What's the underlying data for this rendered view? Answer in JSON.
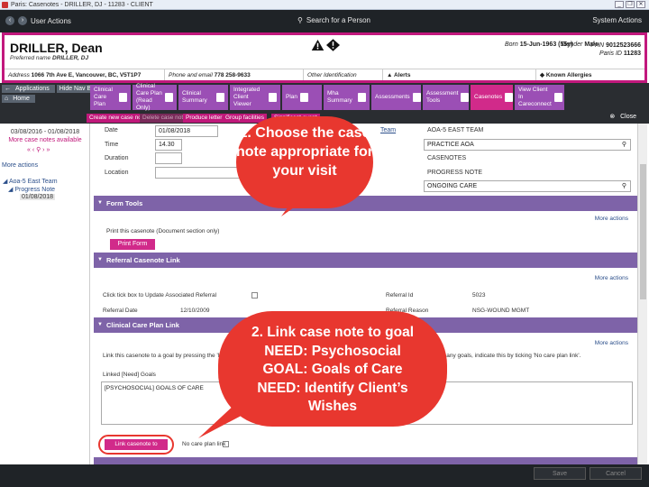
{
  "window": {
    "title": "Paris: Casenotes - DRILLER, DJ - 11283 - CLIENT"
  },
  "topbar": {
    "user_actions": "User Actions",
    "search": "Search for a Person",
    "system_actions": "System Actions"
  },
  "patient": {
    "name": "DRILLER, Dean",
    "preferred_label": "Preferred name",
    "preferred": "DRILLER, DJ",
    "born_label": "Born",
    "born": "15-Jun-1963 (55y)",
    "gender_label": "Gender",
    "gender": "Male",
    "phn_label": "PHN",
    "phn": "9012523666",
    "paris_id_label": "Paris ID",
    "paris_id": "11283",
    "address_label": "Address",
    "address": "1066 7th Ave E, Vancouver, BC, V5T1P7",
    "phone_label": "Phone and email",
    "phone": "778 258-9633",
    "other_id": "Other Identification",
    "alerts": "Alerts",
    "allergies": "Known Allergies"
  },
  "nav": {
    "applications": "Applications",
    "hide_nav": "Hide Nav Bar",
    "home": "Home"
  },
  "modules": [
    {
      "label": "Clinical Care Plan"
    },
    {
      "label": "Clinical Care Plan (Read Only)"
    },
    {
      "label": "Clinical Summary"
    },
    {
      "label": "Integrated Client Viewer"
    },
    {
      "label": "Plan"
    },
    {
      "label": "Mha Summary"
    },
    {
      "label": "Assessments"
    },
    {
      "label": "Assessment Tools"
    },
    {
      "label": "Casenotes"
    },
    {
      "label": "View Client In Careconnect"
    }
  ],
  "actions": {
    "create": "Create new case note",
    "delete": "Delete case note",
    "produce": "Produce letter",
    "group": "Group facilities",
    "significant": "Significant event",
    "close": "Close"
  },
  "left": {
    "range": "03/08/2016 - 01/08/2018",
    "more_notes": "More case notes available",
    "more_actions": "More actions",
    "tree_team": "Aoa-5 East Team",
    "tree_type": "Progress Note",
    "tree_date": "01/08/2018"
  },
  "form": {
    "date_label": "Date",
    "date": "01/08/2018",
    "time_label": "Time",
    "time": "14.30",
    "duration_label": "Duration",
    "location_label": "Location",
    "team_label": "Team",
    "team": "AOA-5 EAST TEAM",
    "practice": "PRACTICE AOA",
    "casenotes": "CASENOTES",
    "progress": "PROGRESS NOTE",
    "ongoing": "ONGOING CARE"
  },
  "form_tools": {
    "header": "Form Tools",
    "more_actions": "More actions",
    "print_text": "Print this casenote (Document section only)",
    "print_btn": "Print Form"
  },
  "referral": {
    "header": "Referral Casenote Link",
    "more_actions": "More actions",
    "tick_text": "Click tick box to Update Associated Referral",
    "date_label": "Referral Date",
    "date": "12/10/2009",
    "id_label": "Referral Id",
    "id": "5023",
    "reason_label": "Referral Reason",
    "reason": "NSG-WOUND MGMT"
  },
  "careplan": {
    "header": "Clinical Care Plan Link",
    "more_actions": "More actions",
    "hint_a": "Link this casenote to a goal by pressing the 'Link",
    "hint_b": "to any goals, indicate this by ticking 'No care plan link'.",
    "linked_label": "Linked [Need] Goals",
    "linked_value": "[PSYCHOSOCIAL] GOALS OF CARE",
    "link_btn": "Link casenote to goal(s)",
    "no_link": "No care plan link"
  },
  "footer": {
    "save": "Save",
    "cancel": "Cancel"
  },
  "callouts": {
    "one": "1. Choose the case note appropriate for your visit",
    "two": "2. Link case note to goal NEED: Psychosocial GOAL: Goals of Care NEED: Identify Client’s Wishes"
  },
  "colors": {
    "accent": "#d12a8a",
    "section": "#7e63a8",
    "callout": "#e8372f"
  }
}
